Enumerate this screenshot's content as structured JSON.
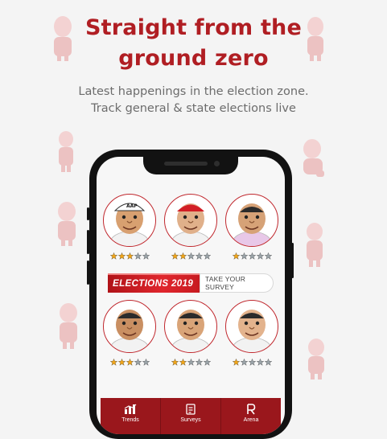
{
  "headline": {
    "line1": "Straight from the",
    "line2": "ground zero"
  },
  "subtitle": {
    "line1": "Latest happenings in the election zone.",
    "line2": "Track general & state elections live"
  },
  "leaders": [
    {
      "rating": 3,
      "outfit": "#f2f2f2",
      "cap": "AAP"
    },
    {
      "rating": 2,
      "outfit": "#f2f2f2",
      "cap": "red"
    },
    {
      "rating": 1,
      "outfit": "#e8c8e8",
      "cap": ""
    },
    {
      "rating": 3,
      "outfit": "#f2f2f2",
      "cap": ""
    },
    {
      "rating": 2,
      "outfit": "#f2f2f2",
      "cap": ""
    },
    {
      "rating": 1,
      "outfit": "#f2f2f2",
      "cap": ""
    }
  ],
  "rating_max": 5,
  "banner": {
    "title": "ELECTIONS 2019",
    "cta": "TAKE YOUR SURVEY"
  },
  "tabs": [
    {
      "label": "Trends",
      "icon": "trends-icon"
    },
    {
      "label": "Surveys",
      "icon": "surveys-icon"
    },
    {
      "label": "Arena",
      "icon": "arena-icon"
    }
  ],
  "colors": {
    "brand": "#b01e23",
    "star_filled": "#f2a516",
    "star_empty": "#9aa3a8",
    "tabbar": "#9a171c"
  }
}
